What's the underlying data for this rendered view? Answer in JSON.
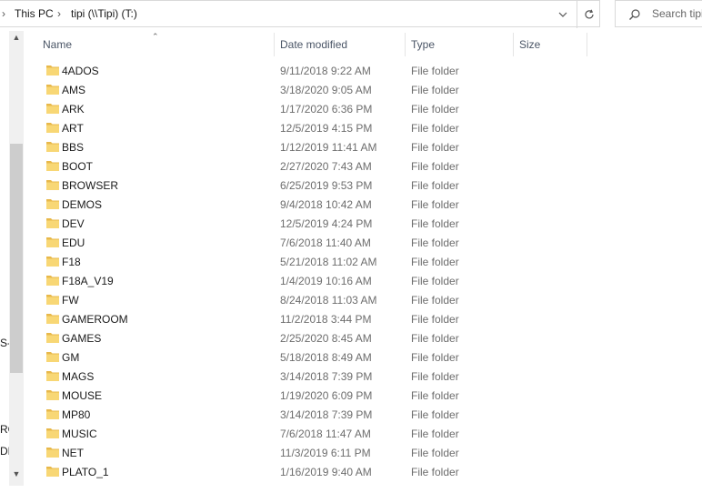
{
  "address_bar": {
    "crumbs": [
      "This PC",
      "tipi (\\\\Tipi) (T:)"
    ]
  },
  "search": {
    "placeholder": "Search tipi"
  },
  "nav_pane": {
    "fragments": [
      "S-(",
      "RO",
      "DE"
    ]
  },
  "columns": {
    "name": "Name",
    "date_modified": "Date modified",
    "type": "Type",
    "size": "Size"
  },
  "files": [
    {
      "name": "4ADOS",
      "date": "9/11/2018 9:22 AM",
      "type": "File folder"
    },
    {
      "name": "AMS",
      "date": "3/18/2020 9:05 AM",
      "type": "File folder"
    },
    {
      "name": "ARK",
      "date": "1/17/2020 6:36 PM",
      "type": "File folder"
    },
    {
      "name": "ART",
      "date": "12/5/2019 4:15 PM",
      "type": "File folder"
    },
    {
      "name": "BBS",
      "date": "1/12/2019 11:41 AM",
      "type": "File folder"
    },
    {
      "name": "BOOT",
      "date": "2/27/2020 7:43 AM",
      "type": "File folder"
    },
    {
      "name": "BROWSER",
      "date": "6/25/2019 9:53 PM",
      "type": "File folder"
    },
    {
      "name": "DEMOS",
      "date": "9/4/2018 10:42 AM",
      "type": "File folder"
    },
    {
      "name": "DEV",
      "date": "12/5/2019 4:24 PM",
      "type": "File folder"
    },
    {
      "name": "EDU",
      "date": "7/6/2018 11:40 AM",
      "type": "File folder"
    },
    {
      "name": "F18",
      "date": "5/21/2018 11:02 AM",
      "type": "File folder"
    },
    {
      "name": "F18A_V19",
      "date": "1/4/2019 10:16 AM",
      "type": "File folder"
    },
    {
      "name": "FW",
      "date": "8/24/2018 11:03 AM",
      "type": "File folder"
    },
    {
      "name": "GAMEROOM",
      "date": "11/2/2018 3:44 PM",
      "type": "File folder"
    },
    {
      "name": "GAMES",
      "date": "2/25/2020 8:45 AM",
      "type": "File folder"
    },
    {
      "name": "GM",
      "date": "5/18/2018 8:49 AM",
      "type": "File folder"
    },
    {
      "name": "MAGS",
      "date": "3/14/2018 7:39 PM",
      "type": "File folder"
    },
    {
      "name": "MOUSE",
      "date": "1/19/2020 6:09 PM",
      "type": "File folder"
    },
    {
      "name": "MP80",
      "date": "3/14/2018 7:39 PM",
      "type": "File folder"
    },
    {
      "name": "MUSIC",
      "date": "7/6/2018 11:47 AM",
      "type": "File folder"
    },
    {
      "name": "NET",
      "date": "11/3/2019 6:11 PM",
      "type": "File folder"
    },
    {
      "name": "PLATO_1",
      "date": "1/16/2019 9:40 AM",
      "type": "File folder"
    }
  ],
  "colors": {
    "folder_fill": "#f8d775",
    "folder_tab": "#e8b84a",
    "header_text": "#4a5566",
    "secondary_text": "#6d6d6d"
  },
  "icons": {
    "back_chevron": "chevron-right-icon",
    "dropdown": "chevron-down-icon",
    "refresh": "refresh-icon",
    "search": "search-icon",
    "folder": "folder-icon",
    "sort": "sort-up-icon"
  }
}
